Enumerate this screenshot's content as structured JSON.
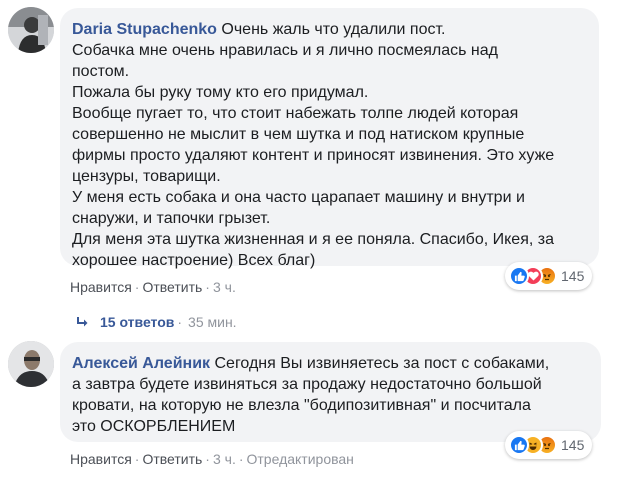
{
  "comments": [
    {
      "author": "Daria Stupachenko",
      "first_line": "Очень жаль что удалили пост.",
      "lines": [
        "Собачка мне очень нравилась и я лично посмеялась над",
        "постом.",
        "Пожала бы руку тому кто его придумал.",
        "Вообще пугает то, что стоит набежать толпе людей которая",
        "совершенно не мыслит в чем шутка и под натиском крупные",
        "фирмы просто удаляют контент и приносят извинения. Это хуже",
        "цензуры, товарищи.",
        "У меня есть собака и она часто царапает машину и внутри и",
        "снаружи, и тапочки грызет.",
        "Для меня эта шутка жизненная и я ее поняла. Спасибо, Икея, за",
        "хорошее настроение) Всех благ)"
      ],
      "reactions": {
        "icons": [
          "like-reaction-icon",
          "love-reaction-icon",
          "angry-reaction-icon"
        ],
        "count": "145"
      },
      "actions": {
        "like": "Нравится",
        "reply": "Ответить",
        "time": "3 ч."
      }
    },
    {
      "author": "Алексей Алейник",
      "first_line": "Сегодня Вы извиняетесь за пост с собаками,",
      "lines": [
        "а завтра будете извиняться за продажу недостаточно большой",
        "кровати, на которую не влезла \"бодипозитивная\" и посчитала",
        "это ОСКОРБЛЕНИЕМ"
      ],
      "reactions": {
        "icons": [
          "like-reaction-icon",
          "haha-reaction-icon",
          "angry-reaction-icon"
        ],
        "count": "145"
      },
      "actions": {
        "like": "Нравится",
        "reply": "Ответить",
        "time": "3 ч.",
        "edited": "Отредактирован"
      }
    }
  ],
  "replies": {
    "label": "15 ответов",
    "time": "35 мин."
  },
  "separator": "·",
  "colors": {
    "author": "#385898",
    "bubble": "#f2f3f5",
    "like": "#1877f2",
    "love": "#f33e58",
    "haha": "#f7b125",
    "angry": "#e9710f"
  }
}
